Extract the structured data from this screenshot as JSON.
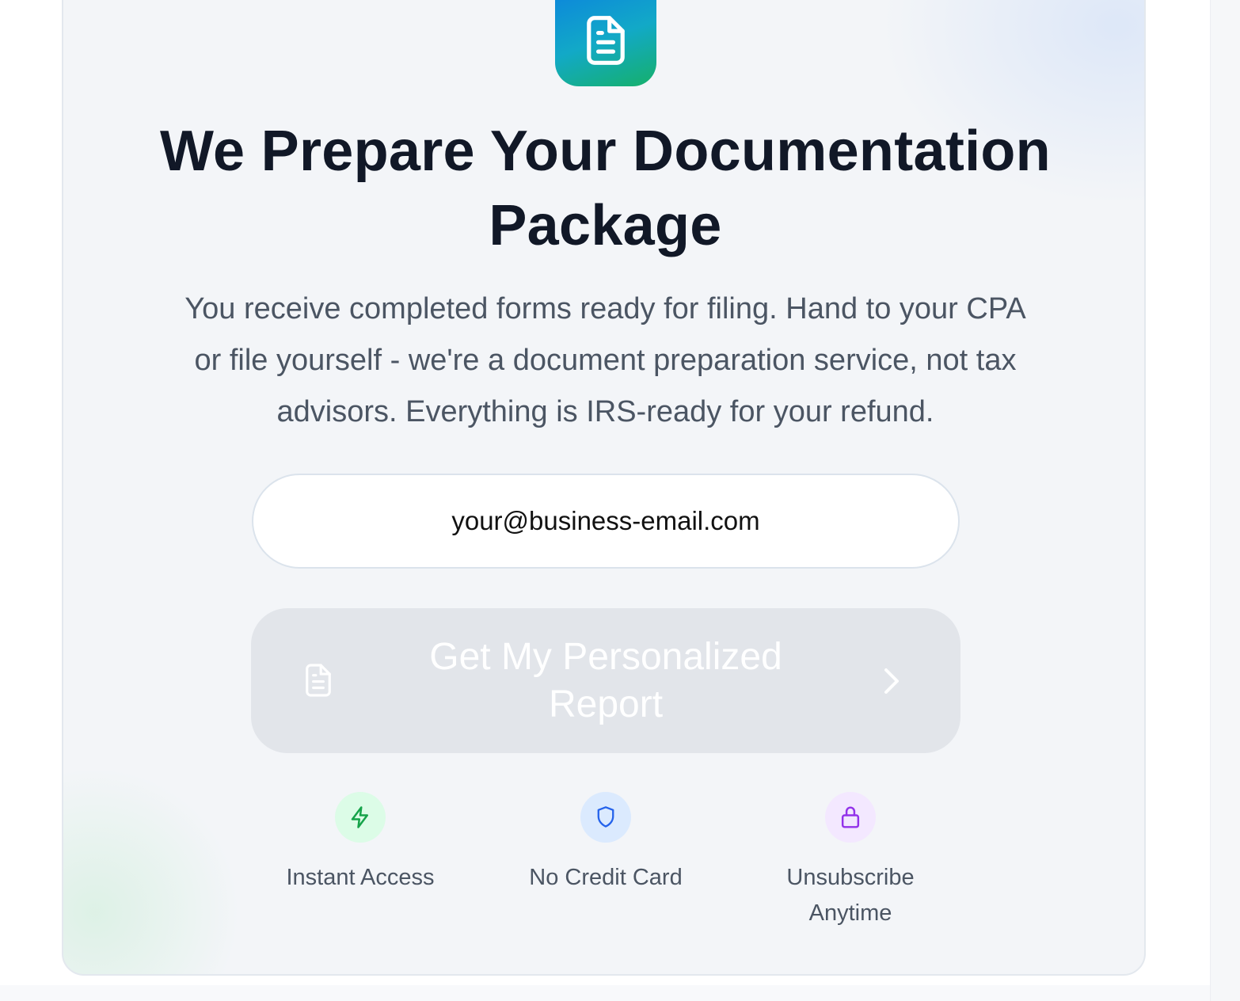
{
  "hero": {
    "icon": "document-icon",
    "title_lines": [
      "We Prepare Your Documentation",
      "Package"
    ],
    "subtitle_lines": [
      "You receive completed forms ready for filing. Hand to your CPA",
      "or file yourself - we're a document preparation service, not tax",
      "advisors. Everything is IRS-ready for your refund."
    ]
  },
  "form": {
    "email_value": "your@business-email.com",
    "cta_lines": [
      "Get My Personalized",
      "Report"
    ],
    "cta_left_icon": "document-icon",
    "cta_right_icon": "chevron-right-icon",
    "cta_state": "disabled"
  },
  "features": [
    {
      "icon": "lightning-icon",
      "label_lines": [
        "Instant Access"
      ],
      "icon_bg": "#dcfce7",
      "icon_color": "#16a34a"
    },
    {
      "icon": "shield-icon",
      "label_lines": [
        "No Credit Card"
      ],
      "icon_bg": "#dbeafe",
      "icon_color": "#2563eb"
    },
    {
      "icon": "lock-icon",
      "label_lines": [
        "Unsubscribe",
        "Anytime"
      ],
      "icon_bg": "#f3e8ff",
      "icon_color": "#9333ea"
    }
  ],
  "colors": {
    "hero_gradient": [
      "#0b7fe0",
      "#12a9c7",
      "#16b06a"
    ],
    "title": "#111827",
    "subtitle": "#4b5563",
    "cta_disabled_bg": "#e2e5ea"
  }
}
